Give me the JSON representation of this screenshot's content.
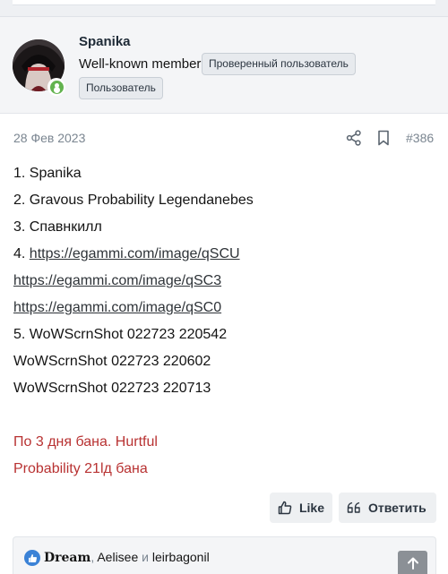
{
  "user": {
    "name": "Spanika",
    "title": "Well-known member",
    "banners": [
      "Проверенный пользователь",
      "Пользователь"
    ],
    "online": true
  },
  "post": {
    "date": "28 Фев 2023",
    "number": "#386",
    "lines": [
      "1. Spanika",
      "2. Gravous Probability Legendanebes",
      "3. Спавнкилл"
    ],
    "link_prefix": "4. ",
    "links": [
      "https://egammi.com/image/qSCU",
      "https://egammi.com/image/qSC3",
      "https://egammi.com/image/qSC0"
    ],
    "screenshots": [
      "5. WoWScrnShot 022723 220542",
      "WoWScrnShot 022723 220602",
      "WoWScrnShot 022723 220713"
    ],
    "moderator_note": [
      "По 3 дня бана. Hurtful",
      "Probability 21lд бана"
    ]
  },
  "actions": {
    "like_label": "Like",
    "reply_label": "Ответить"
  },
  "reactions": {
    "user1": "Dream",
    "sep1": ", ",
    "user2": "Aelisee",
    "conj": " и ",
    "user3": "leirbagonil"
  },
  "colors": {
    "accent_red": "#b83232",
    "online_green": "#63b34f",
    "like_blue": "#3b82d6"
  },
  "icons": {
    "share": "share-icon",
    "bookmark": "bookmark-icon",
    "like": "thumbs-up-icon",
    "reply": "quote-icon",
    "scroll_top": "arrow-up-icon"
  }
}
